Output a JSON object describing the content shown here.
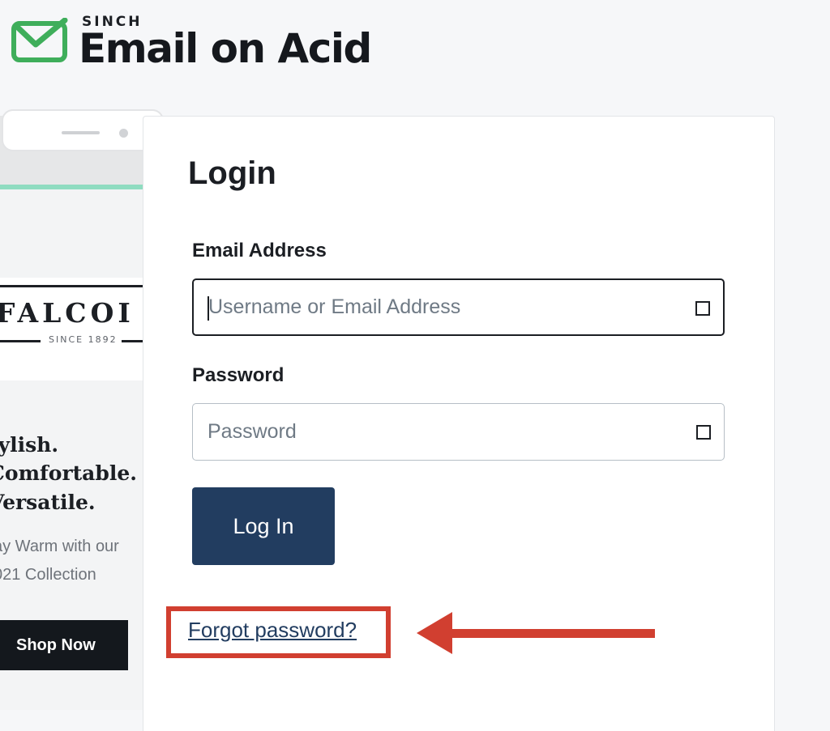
{
  "brand": {
    "sub": "SINCH",
    "name": "Email on Acid",
    "logo_icon": "envelope-check-icon",
    "colors": {
      "logo_green": "#3fae5b",
      "text_dark": "#15181d"
    }
  },
  "preview": {
    "brand_word": "FALCOI",
    "since_text": "SINCE 1892",
    "tagline": [
      "tylish.",
      "Comfortable.",
      "Versatile."
    ],
    "promo": [
      "ay Warm with our",
      "021 Collection"
    ],
    "shop_button": "Shop Now",
    "colors": {
      "accent": "#8fdcc0",
      "shop_button_bg": "#14181d"
    }
  },
  "login": {
    "title": "Login",
    "email_label": "Email Address",
    "email_placeholder": "Username or Email Address",
    "email_value": "",
    "password_label": "Password",
    "password_placeholder": "Password",
    "password_value": "",
    "submit_label": "Log In",
    "forgot_link": "Forgot password?",
    "field_icon": "square-icon",
    "colors": {
      "button_bg": "#223d60",
      "link": "#223d60",
      "highlight": "#d13f30"
    }
  },
  "annotation": {
    "highlight_target": "forgot-password-link",
    "arrow_icon": "left-arrow-icon",
    "color": "#d13f30"
  }
}
